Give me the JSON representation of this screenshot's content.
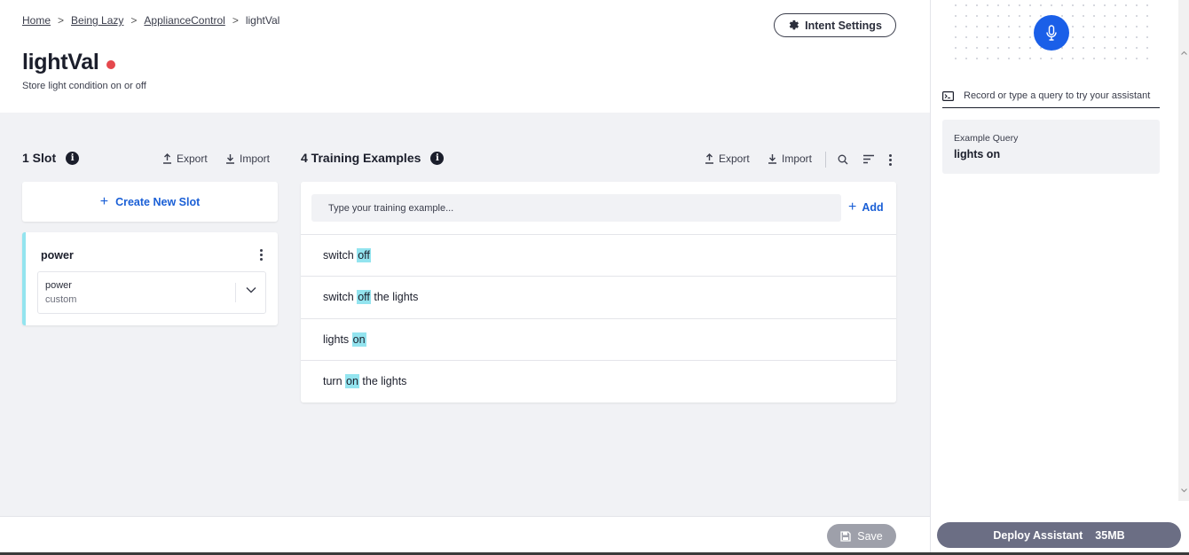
{
  "breadcrumb": {
    "home": "Home",
    "assistant": "Being Lazy",
    "domain": "ApplianceControl",
    "current": "lightVal",
    "separator": ">"
  },
  "intent": {
    "title": "lightVal",
    "description": "Store light condition on or off",
    "settings_label": "Intent Settings"
  },
  "slots": {
    "heading": "1 Slot",
    "export_label": "Export",
    "import_label": "Import",
    "create_label": "Create New Slot",
    "items": [
      {
        "name": "power",
        "entity_name": "power",
        "entity_type": "custom"
      }
    ]
  },
  "training": {
    "heading": "4 Training Examples",
    "export_label": "Export",
    "import_label": "Import",
    "input_placeholder": "Type your training example...",
    "add_label": "Add",
    "examples": [
      {
        "before": "switch ",
        "slot": "off",
        "after": ""
      },
      {
        "before": "switch ",
        "slot": "off",
        "after": " the lights"
      },
      {
        "before": "lights ",
        "slot": "on",
        "after": ""
      },
      {
        "before": "turn ",
        "slot": "on",
        "after": " the lights"
      }
    ]
  },
  "try_panel": {
    "query_placeholder": "Record or type a query to try your assistant",
    "example_label": "Example Query",
    "example_value": "lights on"
  },
  "footer": {
    "save_label": "Save",
    "deploy_label": "Deploy Assistant",
    "deploy_size": "35MB"
  },
  "colors": {
    "accent": "#1a5fd6",
    "mic": "#1a5fe8",
    "slot_highlight": "#93e4ef",
    "status_dot": "#e5484d",
    "background": "#f1f2f5"
  },
  "icons": [
    "gear-icon",
    "info-icon",
    "upload-icon",
    "download-icon",
    "plus-icon",
    "kebab-icon",
    "chevron-down-icon",
    "search-icon",
    "sort-icon",
    "mic-icon",
    "terminal-icon",
    "save-icon"
  ]
}
